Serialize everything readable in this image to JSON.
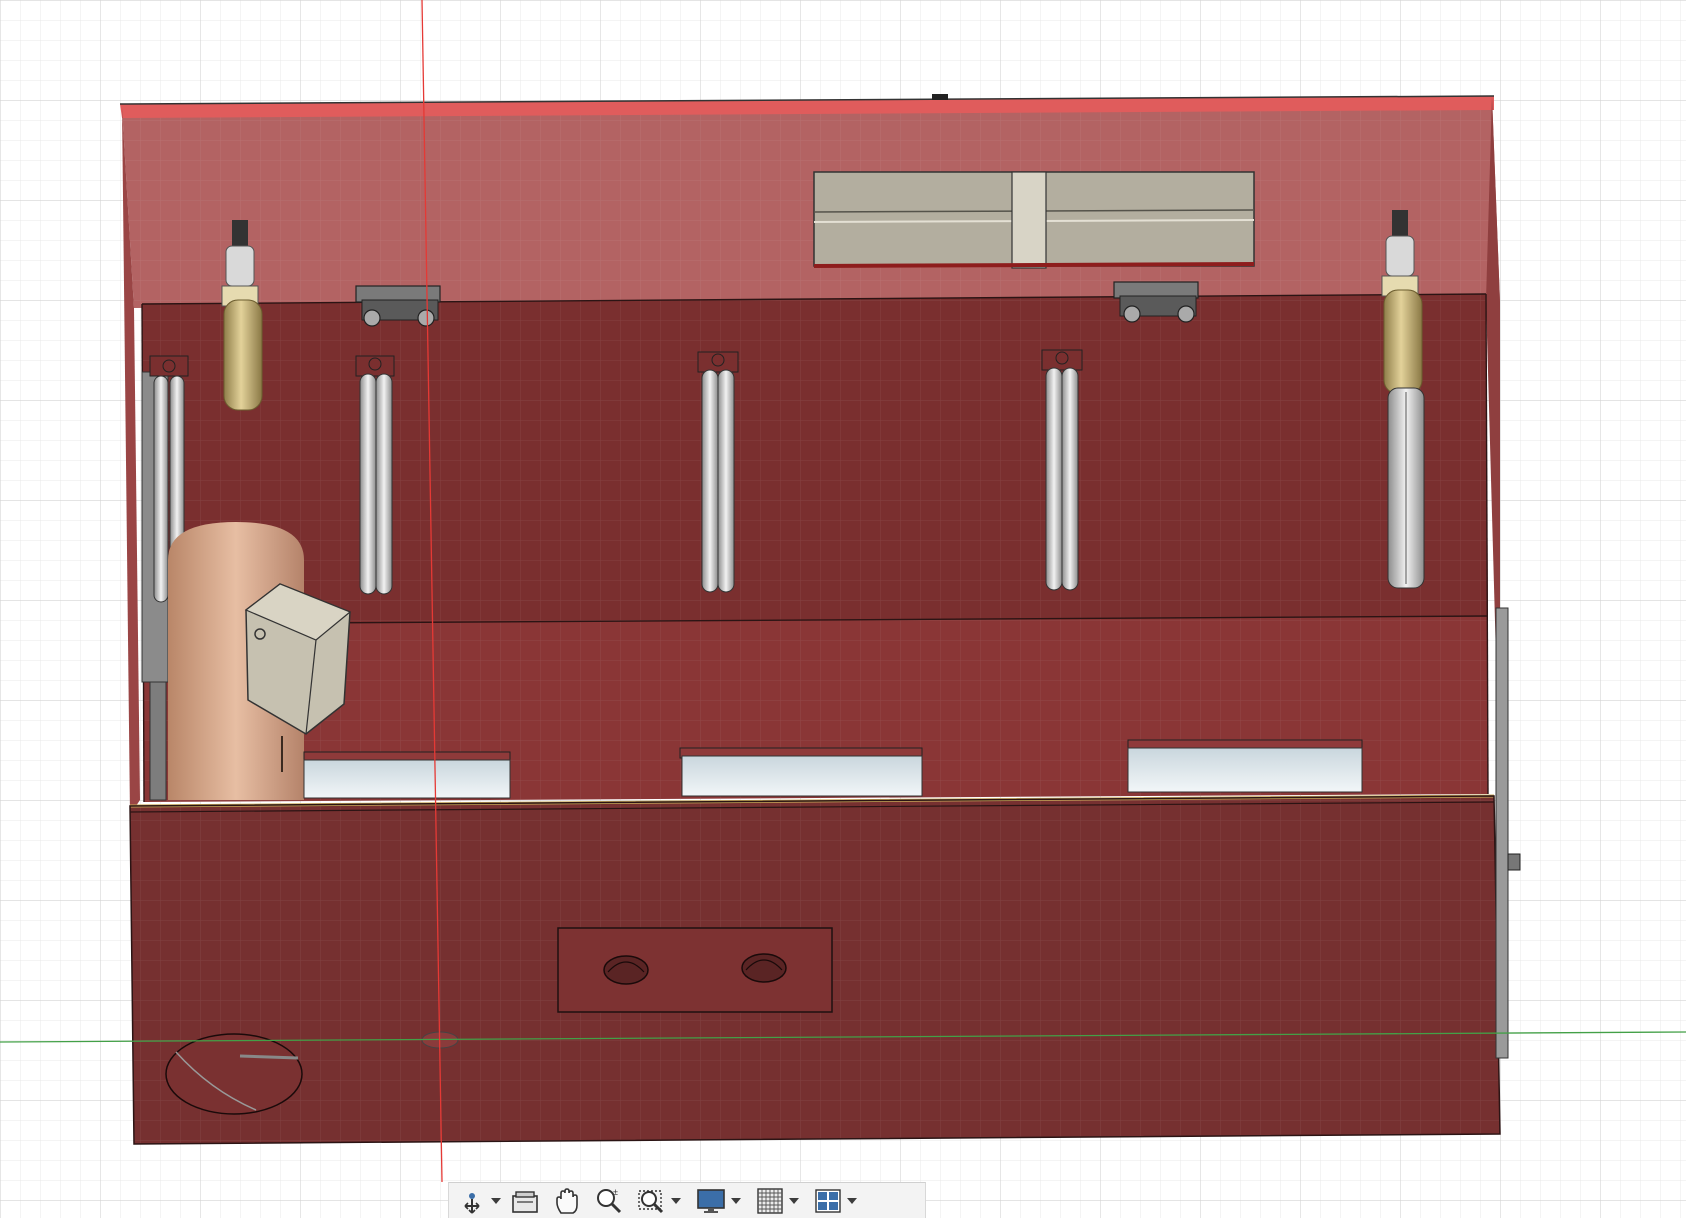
{
  "app": {
    "view": "3d-model-viewport"
  },
  "viewport": {
    "colors": {
      "background": "#ffffff",
      "grid_minor": "#e6e6e6",
      "grid_major": "#d2d2d2",
      "axis_red": "#e53935",
      "axis_green": "#43a047",
      "body_outer": "#a64b4b",
      "body_inner": "#7a2e2e",
      "body_front": "#732f2f",
      "top_rim": "#e0595a",
      "tube_metal": "#cfcfcf",
      "window_glass": "#dfe9ee",
      "brass": "#bda86a",
      "wood": "#d7a88c",
      "box_gray": "#bdb8a8"
    }
  },
  "toolbar": {
    "items": [
      {
        "name": "orbit",
        "icon": "orbit-icon",
        "has_menu": true
      },
      {
        "name": "look-at",
        "icon": "look-at-icon",
        "has_menu": false
      },
      {
        "name": "pan",
        "icon": "pan-hand-icon",
        "has_menu": false
      },
      {
        "name": "zoom",
        "icon": "zoom-icon",
        "has_menu": false
      },
      {
        "name": "fit",
        "icon": "zoom-window-icon",
        "has_menu": true
      },
      {
        "name": "display-settings",
        "icon": "display-monitor-icon",
        "has_menu": true
      },
      {
        "name": "grid-snaps",
        "icon": "grid-icon",
        "has_menu": true
      },
      {
        "name": "viewports",
        "icon": "viewports-icon",
        "has_menu": true
      }
    ]
  }
}
